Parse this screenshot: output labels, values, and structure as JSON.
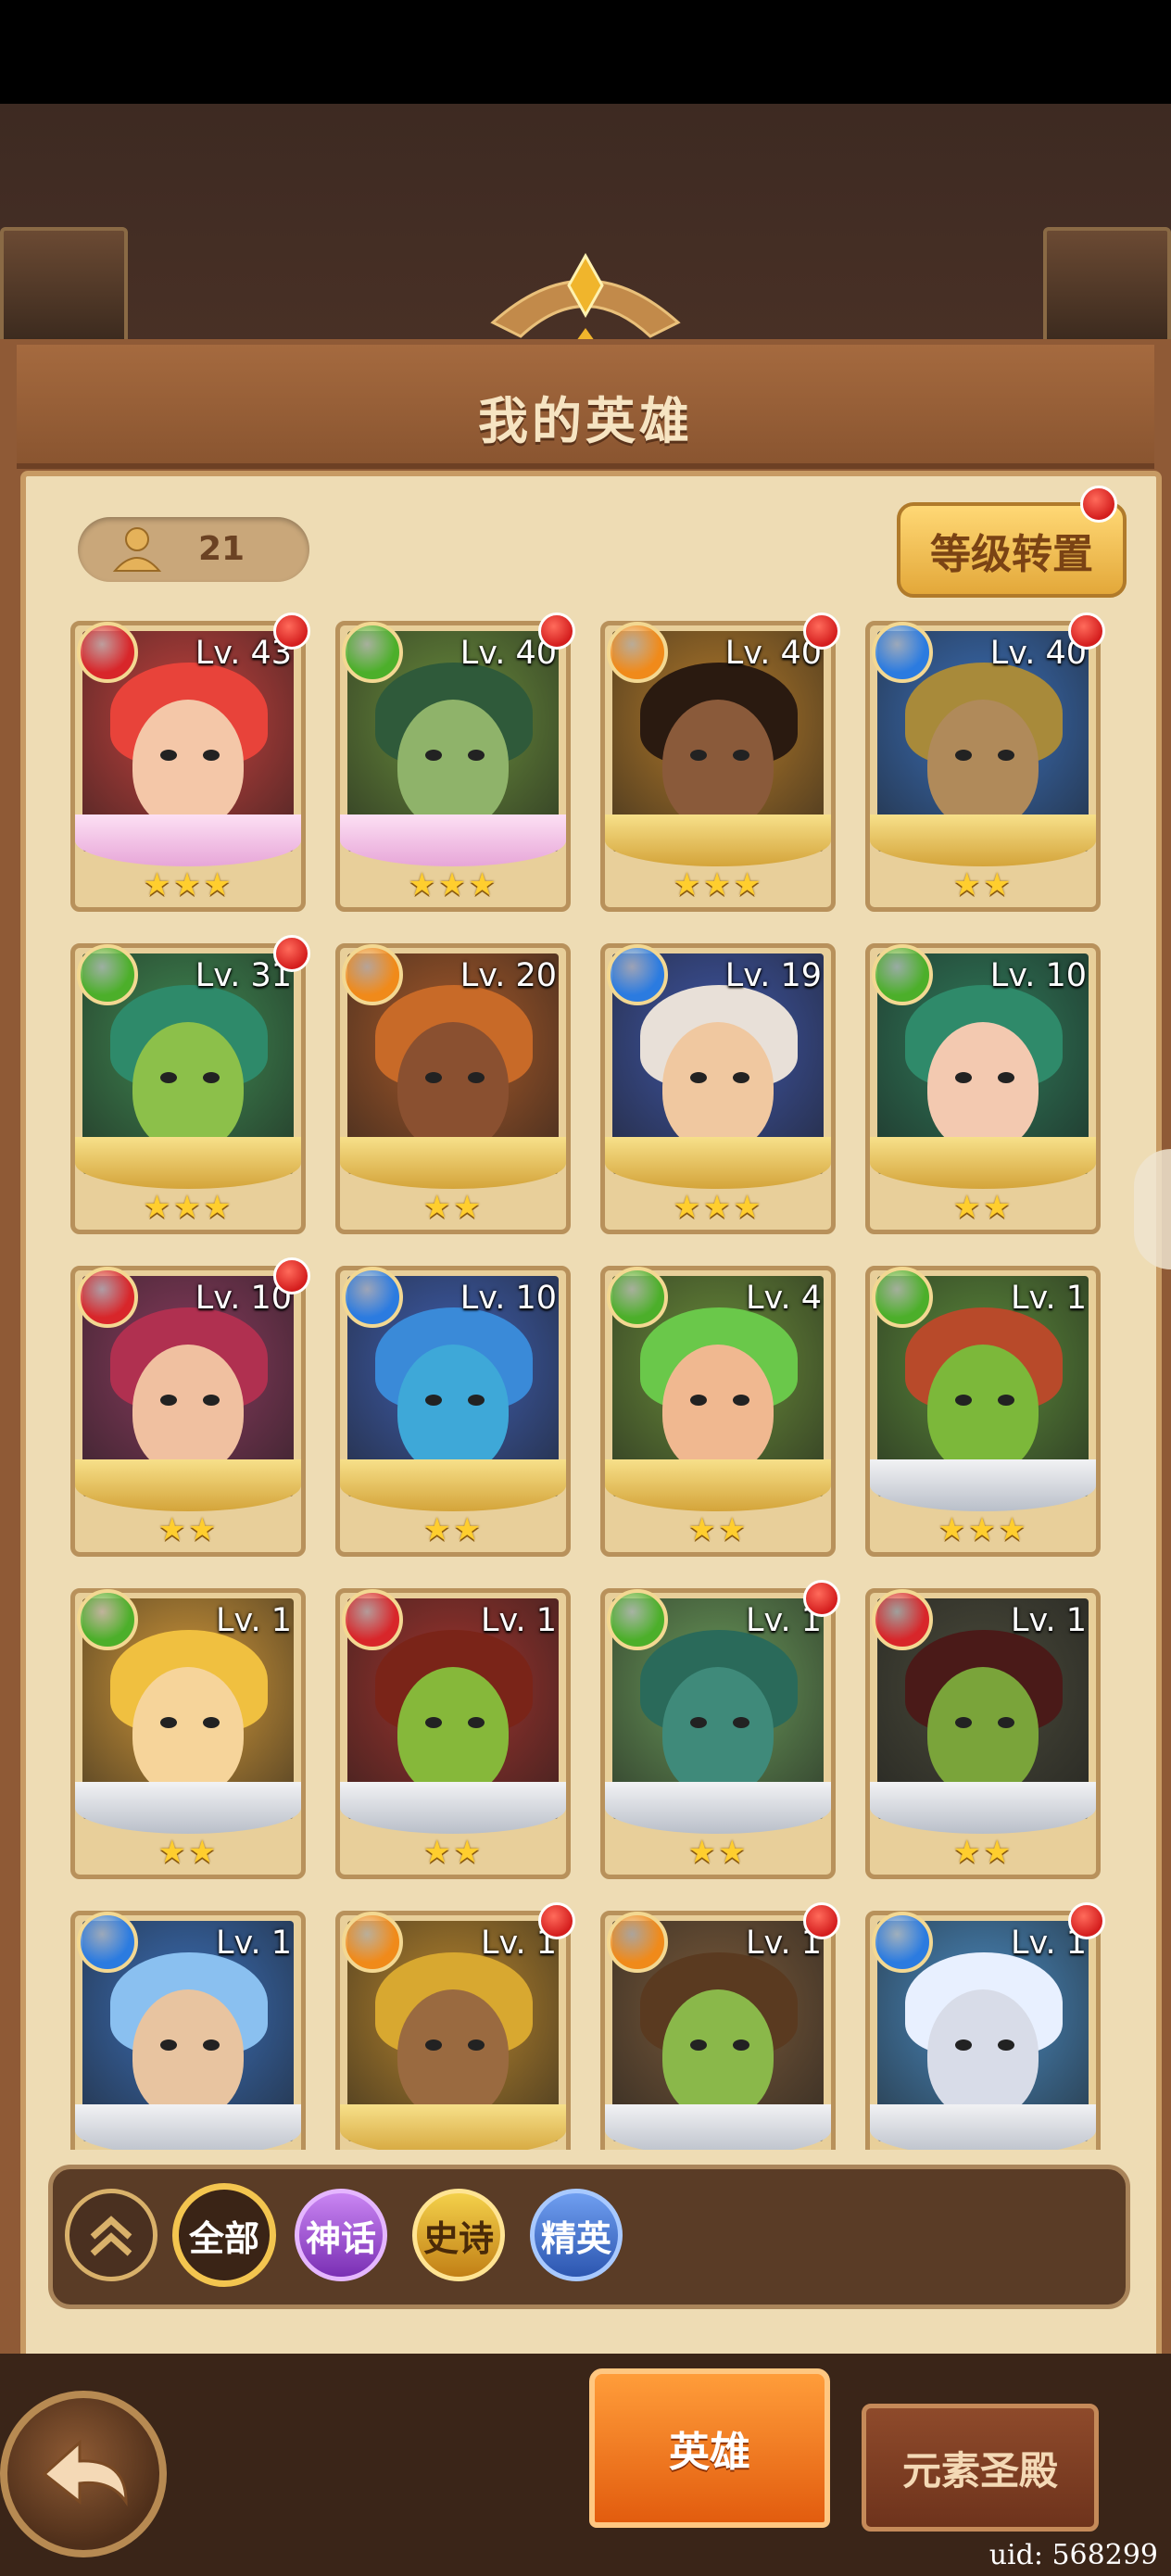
{
  "header": {
    "title": "我的英雄"
  },
  "hero_count": "21",
  "level_transfer_label": "等级转置",
  "heroes": [
    {
      "level": "Lv. 43",
      "element": "fire",
      "stars": 3,
      "rarity_base": "mythic",
      "alert": true
    },
    {
      "level": "Lv. 40",
      "element": "nature",
      "stars": 3,
      "rarity_base": "mythic",
      "alert": true
    },
    {
      "level": "Lv. 40",
      "element": "light",
      "stars": 3,
      "rarity_base": "epic",
      "alert": true
    },
    {
      "level": "Lv. 40",
      "element": "water",
      "stars": 2,
      "rarity_base": "epic",
      "alert": true
    },
    {
      "level": "Lv. 31",
      "element": "nature",
      "stars": 3,
      "rarity_base": "epic",
      "alert": true
    },
    {
      "level": "Lv. 20",
      "element": "light",
      "stars": 2,
      "rarity_base": "epic",
      "alert": false
    },
    {
      "level": "Lv. 19",
      "element": "water",
      "stars": 3,
      "rarity_base": "epic",
      "alert": false
    },
    {
      "level": "Lv. 10",
      "element": "nature",
      "stars": 2,
      "rarity_base": "epic",
      "alert": false
    },
    {
      "level": "Lv. 10",
      "element": "fire",
      "stars": 2,
      "rarity_base": "epic",
      "alert": true
    },
    {
      "level": "Lv. 10",
      "element": "water",
      "stars": 2,
      "rarity_base": "epic",
      "alert": false
    },
    {
      "level": "Lv. 4",
      "element": "nature",
      "stars": 2,
      "rarity_base": "epic",
      "alert": false
    },
    {
      "level": "Lv. 1",
      "element": "nature",
      "stars": 3,
      "rarity_base": "elite",
      "alert": false
    },
    {
      "level": "Lv. 1",
      "element": "nature",
      "stars": 2,
      "rarity_base": "elite",
      "alert": false
    },
    {
      "level": "Lv. 1",
      "element": "fire",
      "stars": 2,
      "rarity_base": "elite",
      "alert": false
    },
    {
      "level": "Lv. 1",
      "element": "nature",
      "stars": 2,
      "rarity_base": "elite",
      "alert": true
    },
    {
      "level": "Lv. 1",
      "element": "fire",
      "stars": 2,
      "rarity_base": "elite",
      "alert": false
    },
    {
      "level": "Lv. 1",
      "element": "water",
      "stars": 0,
      "rarity_base": "elite",
      "alert": false
    },
    {
      "level": "Lv. 1",
      "element": "light",
      "stars": 0,
      "rarity_base": "epic",
      "alert": true
    },
    {
      "level": "Lv. 1",
      "element": "light",
      "stars": 0,
      "rarity_base": "elite",
      "alert": true
    },
    {
      "level": "Lv. 1",
      "element": "water",
      "stars": 0,
      "rarity_base": "elite",
      "alert": true
    }
  ],
  "filters": {
    "all": "全部",
    "myth": "神话",
    "epic": "史诗",
    "elite": "精英"
  },
  "tabs": {
    "hero": "英雄",
    "shrine": "元素圣殿"
  },
  "uid": "uid: 568299",
  "colors": {
    "fire": "#d8262a",
    "nature": "#4caf2a",
    "light": "#f08a1a",
    "water": "#2b7be0"
  },
  "element_icons": {
    "fire": "flame-icon",
    "nature": "leaf-icon",
    "light": "sun-icon",
    "water": "droplet-icon"
  }
}
